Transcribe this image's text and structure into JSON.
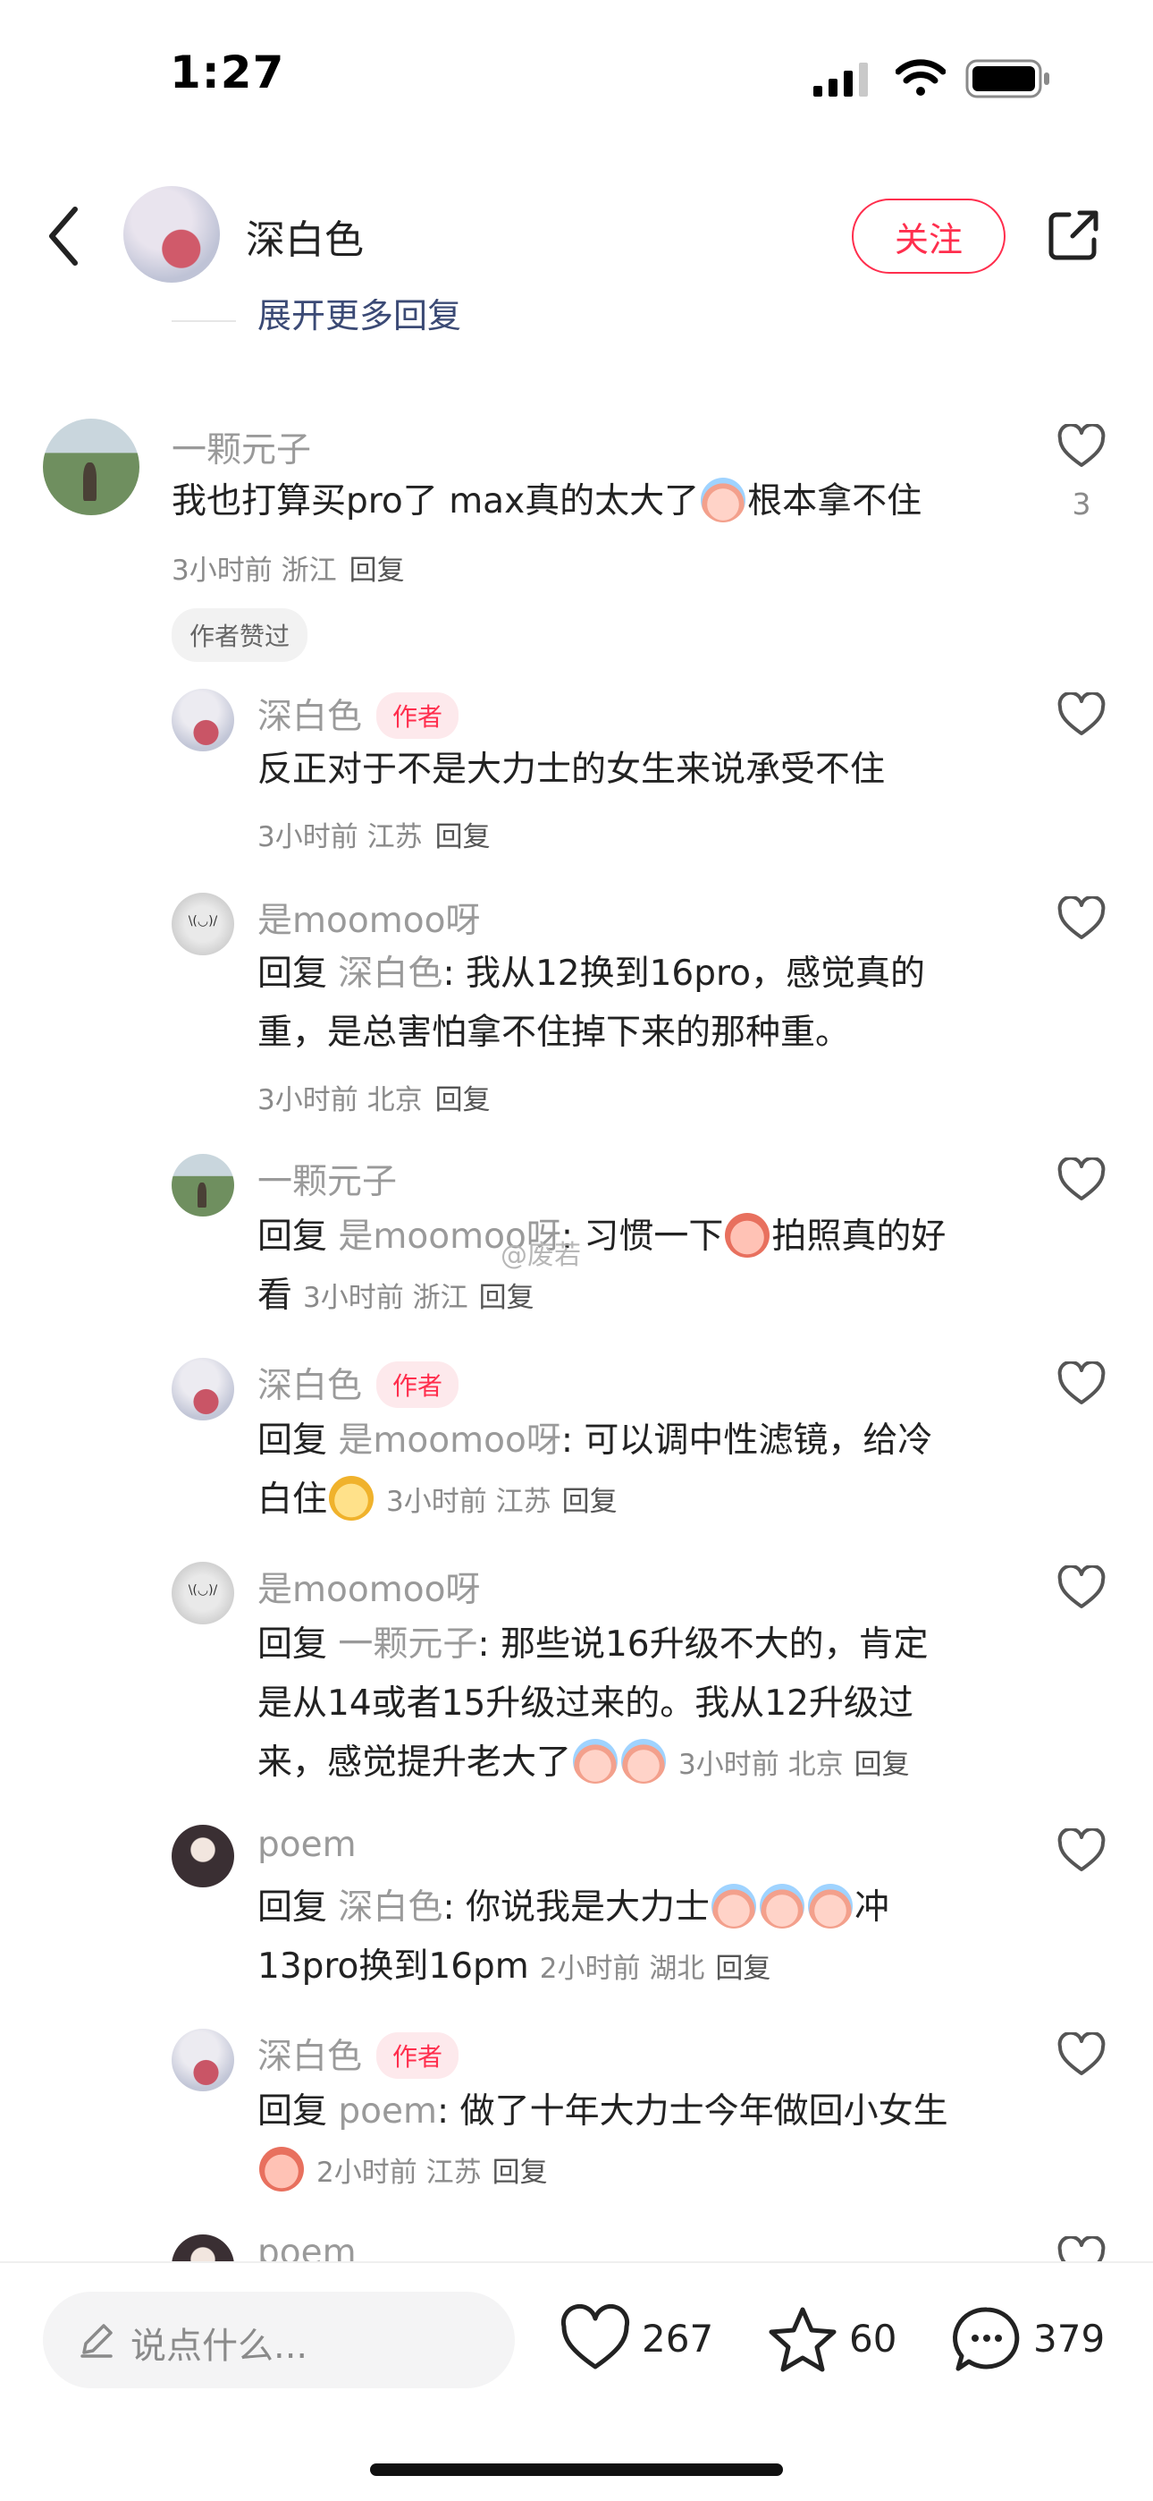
{
  "status_bar": {
    "time": "1:27"
  },
  "header": {
    "user_name": "深白色",
    "follow_label": "关注"
  },
  "expand_more": "展开更多回复",
  "top_comment": {
    "author": "一颗元子",
    "text": "我也打算买pro了 max真的太大了",
    "text_tail": "根本拿不住",
    "time": "3小时前",
    "location": "浙江",
    "reply_label": "回复",
    "like_count": "3",
    "badge": "作者赞过"
  },
  "author_tag": "作者",
  "replies": [
    {
      "author": "深白色",
      "text": "反正对于不是大力士的女生来说承受不住",
      "time": "3小时前",
      "location": "江苏",
      "reply_label": "回复"
    },
    {
      "author": "是moomoo呀",
      "prefix": "回复",
      "to": "深白色",
      "text_a": ": 我从12换到16pro，感觉真的",
      "text_b": "重，是总害怕拿不住掉下来的那种重。",
      "time": "3小时前",
      "location": "北京",
      "reply_label": "回复"
    },
    {
      "author": "一颗元子",
      "prefix": "回复",
      "to": "是moomoo呀",
      "text_a": ": 习惯一下",
      "text_b": "拍照真的好",
      "text_c": "看",
      "time": "3小时前",
      "location": "浙江",
      "reply_label": "回复"
    },
    {
      "author": "深白色",
      "prefix": "回复",
      "to": "是moomoo呀",
      "text_a": ": 可以调中性滤镜，给冷",
      "text_b": "白住",
      "time": "3小时前",
      "location": "江苏",
      "reply_label": "回复"
    },
    {
      "author": "是moomoo呀",
      "prefix": "回复",
      "to": "一颗元子",
      "text_a": ": 那些说16升级不大的，肯定",
      "text_b": "是从14或者15升级过来的。我从12升级过",
      "text_c": "来，感觉提升老大了",
      "time": "3小时前",
      "location": "北京",
      "reply_label": "回复"
    },
    {
      "author": "poem",
      "prefix": "回复",
      "to": "深白色",
      "text_a": ": 你说我是大力士",
      "text_b": "冲",
      "text_c": "13pro换到16pm",
      "time": "2小时前",
      "location": "湖北",
      "reply_label": "回复"
    },
    {
      "author": "深白色",
      "prefix": "回复",
      "to": "poem",
      "text_a": ": 做了十年大力士今年做回小女生",
      "time": "2小时前",
      "location": "江苏",
      "reply_label": "回复"
    },
    {
      "author": "poem"
    }
  ],
  "watermark": "@废若",
  "bottom_bar": {
    "input_placeholder": "说点什么...",
    "like_count": "267",
    "star_count": "60",
    "comment_count": "379"
  }
}
